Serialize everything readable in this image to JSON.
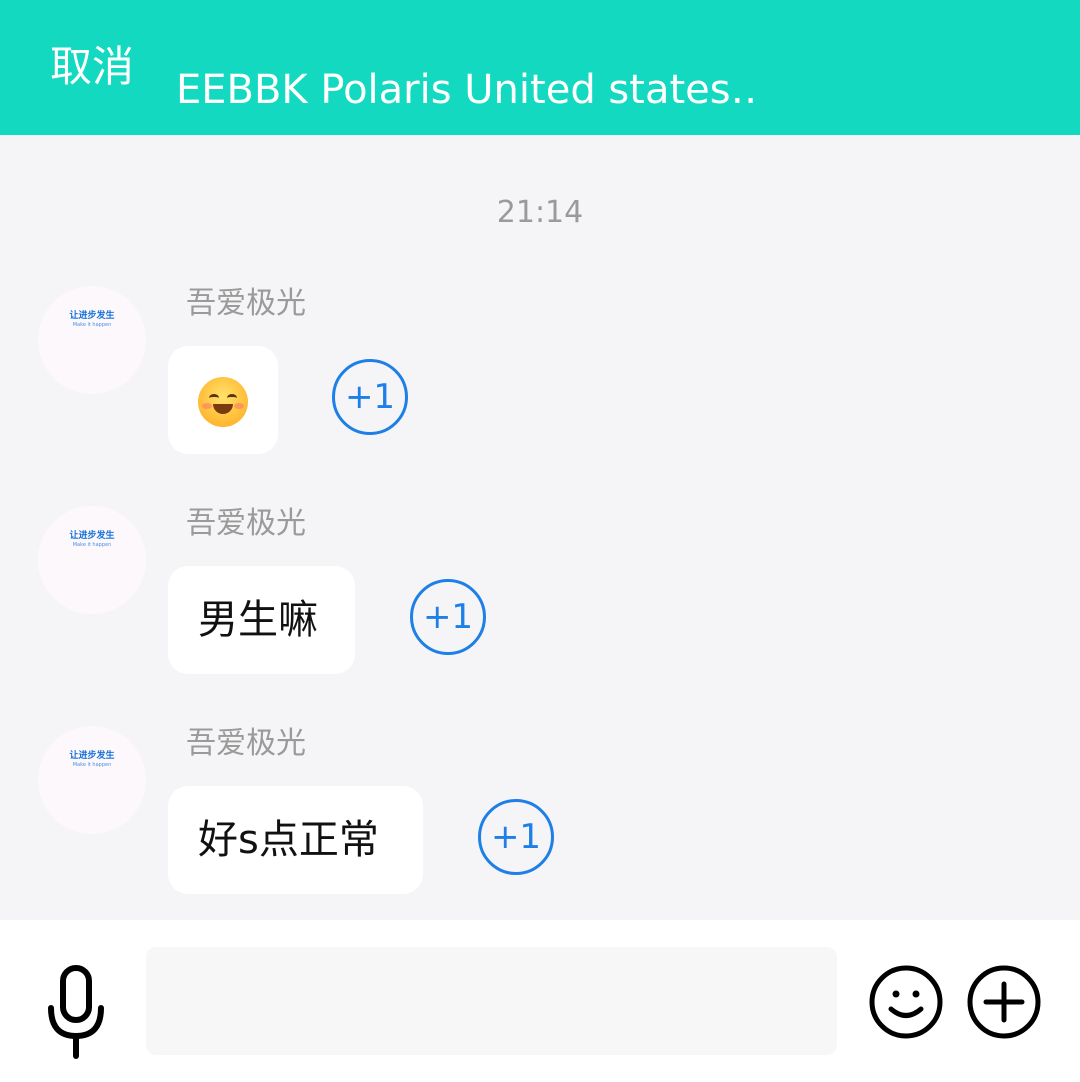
{
  "header": {
    "cancel_label": "取消",
    "title": "EEBBK Polaris United states…"
  },
  "chat": {
    "timestamp": "21:14",
    "avatar_text": "让进步发生",
    "avatar_subtext": "Make it happen",
    "messages": [
      {
        "sender": "吾爱极光",
        "text": "",
        "emoji": "smiling-face-with-blush-icon",
        "plus_label": "+1"
      },
      {
        "sender": "吾爱极光",
        "text": "男生嘛",
        "plus_label": "+1"
      },
      {
        "sender": "吾爱极光",
        "text": "好s点正常",
        "plus_label": "+1"
      }
    ]
  },
  "bottom": {
    "input_value": "",
    "icons": [
      "microphone-icon",
      "emoji-face-icon",
      "add-circle-icon"
    ]
  },
  "colors": {
    "header_bg": "#13d9c0",
    "chat_bg": "#f5f5f7",
    "accent_blue": "#1e7fe6"
  }
}
